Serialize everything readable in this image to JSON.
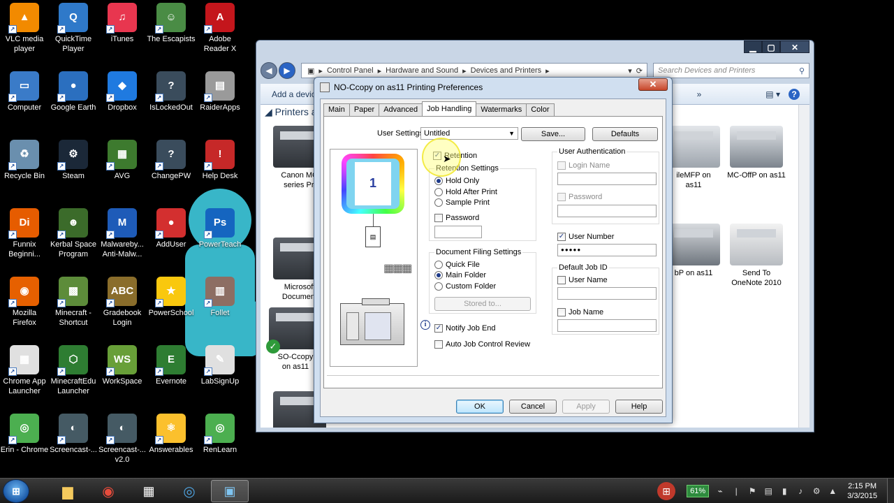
{
  "desktop": {
    "icons": [
      {
        "label": "VLC media player",
        "icon": "vlc-icon",
        "color": "#f28a00",
        "glyph": "▲"
      },
      {
        "label": "QuickTime Player",
        "icon": "quicktime-icon",
        "color": "#2f79c9",
        "glyph": "Q"
      },
      {
        "label": "iTunes",
        "icon": "itunes-icon",
        "color": "#e8364f",
        "glyph": "♫"
      },
      {
        "label": "The Escapists",
        "icon": "escapists-icon",
        "color": "#4a8c45",
        "glyph": "☺"
      },
      {
        "label": "Adobe Reader X",
        "icon": "adobe-reader-icon",
        "color": "#c4161c",
        "glyph": "A"
      },
      {
        "label": "Computer",
        "icon": "computer-icon",
        "color": "#3a7bc8",
        "glyph": "▭"
      },
      {
        "label": "Google Earth",
        "icon": "google-earth-icon",
        "color": "#2b6fbf",
        "glyph": "●"
      },
      {
        "label": "Dropbox",
        "icon": "dropbox-icon",
        "color": "#1f7ae0",
        "glyph": "◆"
      },
      {
        "label": "IsLockedOut",
        "icon": "islockedout-icon",
        "color": "#3a4c5c",
        "glyph": "?"
      },
      {
        "label": "RaiderApps",
        "icon": "raiderapps-icon",
        "color": "#9a9a9a",
        "glyph": "▤"
      },
      {
        "label": "Recycle Bin",
        "icon": "recycle-bin-icon",
        "color": "#6a8fae",
        "glyph": "♻"
      },
      {
        "label": "Steam",
        "icon": "steam-icon",
        "color": "#1b2838",
        "glyph": "⚙"
      },
      {
        "label": "AVG",
        "icon": "avg-icon",
        "color": "#3d7a2e",
        "glyph": "▦"
      },
      {
        "label": "ChangePW",
        "icon": "changepw-icon",
        "color": "#3a4c5c",
        "glyph": "?"
      },
      {
        "label": "Help Desk",
        "icon": "help-desk-icon",
        "color": "#c62828",
        "glyph": "!"
      },
      {
        "label": "Funnix Beginni...",
        "icon": "funnix-icon",
        "color": "#e65c00",
        "glyph": "Di"
      },
      {
        "label": "Kerbal Space Program",
        "icon": "kerbal-icon",
        "color": "#3b6b2a",
        "glyph": "☻"
      },
      {
        "label": "Malwareby... Anti-Malw...",
        "icon": "malwarebytes-icon",
        "color": "#1e5bb8",
        "glyph": "M"
      },
      {
        "label": "AddUser",
        "icon": "adduser-icon",
        "color": "#d32f2f",
        "glyph": "●"
      },
      {
        "label": "PowerTeach",
        "icon": "powerteach-icon",
        "color": "#1565c0",
        "glyph": "Ps"
      },
      {
        "label": "Mozilla Firefox",
        "icon": "firefox-icon",
        "color": "#e66000",
        "glyph": "◉"
      },
      {
        "label": "Minecraft - Shortcut",
        "icon": "minecraft-icon",
        "color": "#5d8c3a",
        "glyph": "▩"
      },
      {
        "label": "Gradebook Login",
        "icon": "gradebook-icon",
        "color": "#8a6d2b",
        "glyph": "ABC"
      },
      {
        "label": "PowerSchool",
        "icon": "powerschool-icon",
        "color": "#f9c80e",
        "glyph": "★"
      },
      {
        "label": "Follet",
        "icon": "follet-icon",
        "color": "#8d6e63",
        "glyph": "▥"
      },
      {
        "label": "Chrome App Launcher",
        "icon": "chrome-app-launcher-icon",
        "color": "#e0e0e0",
        "glyph": "▦"
      },
      {
        "label": "MinecraftEdu Launcher",
        "icon": "minecraftedu-icon",
        "color": "#2e7d32",
        "glyph": "⬡"
      },
      {
        "label": "WorkSpace",
        "icon": "workspace-icon",
        "color": "#689f38",
        "glyph": "WS"
      },
      {
        "label": "Evernote",
        "icon": "evernote-icon",
        "color": "#2e7d32",
        "glyph": "E"
      },
      {
        "label": "LabSignUp",
        "icon": "labsignup-icon",
        "color": "#e0e0e0",
        "glyph": "✎"
      },
      {
        "label": "Erin - Chrome",
        "icon": "chrome-icon",
        "color": "#4caf50",
        "glyph": "◎"
      },
      {
        "label": "Screencast-...",
        "icon": "screencast-icon",
        "color": "#455a64",
        "glyph": "◐"
      },
      {
        "label": "Screencast-... v2.0",
        "icon": "screencast-v2-icon",
        "color": "#455a64",
        "glyph": "◐"
      },
      {
        "label": "Answerables",
        "icon": "answerables-icon",
        "color": "#fbc02d",
        "glyph": "⚛"
      },
      {
        "label": "RenLearn",
        "icon": "renlearn-icon",
        "color": "#4caf50",
        "glyph": "◎"
      }
    ]
  },
  "explorer": {
    "breadcrumb": [
      "Control Panel",
      "Hardware and Sound",
      "Devices and Printers"
    ],
    "search_placeholder": "Search Devices and Printers",
    "cmd_add_device": "Add a device",
    "group_header": "Printers a",
    "devices": [
      {
        "label": "Canon MG series Pri"
      },
      {
        "label": "Microsoft Document"
      },
      {
        "label": "SO-Ccopy on as11"
      },
      {
        "label": "ileMFP on as11"
      },
      {
        "label": "MC-OffP on as11"
      },
      {
        "label": "bP on as11"
      },
      {
        "label": "Send To OneNote 2010"
      }
    ]
  },
  "dialog": {
    "title": "NO-Ccopy on as11 Printing Preferences",
    "tabs": [
      "Main",
      "Paper",
      "Advanced",
      "Job Handling",
      "Watermarks",
      "Color"
    ],
    "active_tab": "Job Handling",
    "user_settings_label": "User Settings:",
    "user_settings_value": "Untitled",
    "save_button": "Save...",
    "defaults_button": "Defaults",
    "preview_page_number": "1",
    "retention_label": "Retention",
    "retention_settings_label": "Retention Settings",
    "hold_only": "Hold Only",
    "hold_after_print": "Hold After Print",
    "sample_print": "Sample Print",
    "password_label": "Password",
    "document_filing_label": "Document Filing Settings",
    "quick_file": "Quick File",
    "main_folder": "Main Folder",
    "custom_folder": "Custom Folder",
    "stored_to_button": "Stored to...",
    "notify_job_end": "Notify Job End",
    "auto_job_control": "Auto Job Control Review",
    "user_auth_label": "User Authentication",
    "login_name": "Login Name",
    "auth_password": "Password",
    "user_number": "User Number",
    "user_number_value": "●●●●●",
    "default_job_id": "Default Job ID",
    "user_name": "User Name",
    "job_name": "Job Name",
    "ok": "OK",
    "cancel": "Cancel",
    "apply": "Apply",
    "help": "Help"
  },
  "taskbar": {
    "battery": "61%",
    "time": "2:15 PM",
    "date": "3/3/2015"
  }
}
